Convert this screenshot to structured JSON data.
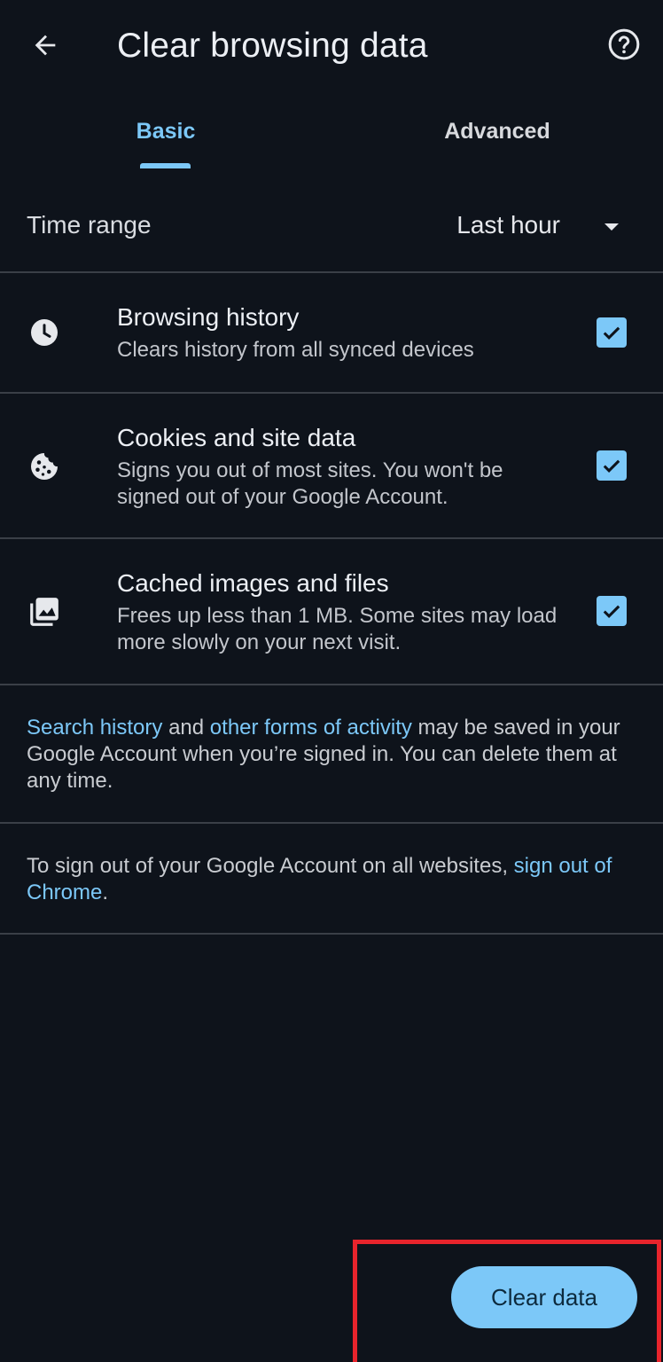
{
  "appbar": {
    "title": "Clear browsing data",
    "back_icon": "arrow-back-icon",
    "help_icon": "help-circle-icon"
  },
  "tabs": [
    {
      "label": "Basic",
      "selected": true
    },
    {
      "label": "Advanced",
      "selected": false
    }
  ],
  "time_range": {
    "label": "Time range",
    "value": "Last hour"
  },
  "options": [
    {
      "icon": "clock-icon",
      "title": "Browsing history",
      "description": "Clears history from all synced devices",
      "checked": true
    },
    {
      "icon": "cookie-icon",
      "title": "Cookies and site data",
      "description": "Signs you out of most sites. You won't be signed out of your Google Account.",
      "checked": true
    },
    {
      "icon": "image-gallery-icon",
      "title": "Cached images and files",
      "description": "Frees up less than 1 MB. Some sites may load more slowly on your next visit.",
      "checked": true
    }
  ],
  "notice1": {
    "link1": "Search history",
    "text1": " and ",
    "link2": "other forms of activity",
    "text2": " may be saved in your Google Account when you’re signed in. You can delete them at any time."
  },
  "notice2": {
    "text1": "To sign out of your Google Account on all websites, ",
    "link": "sign out of Chrome",
    "text2": "."
  },
  "action": {
    "clear_label": "Clear data"
  },
  "colors": {
    "background": "#0e131b",
    "accent": "#7cc8f8",
    "highlight": "#e8242c"
  }
}
